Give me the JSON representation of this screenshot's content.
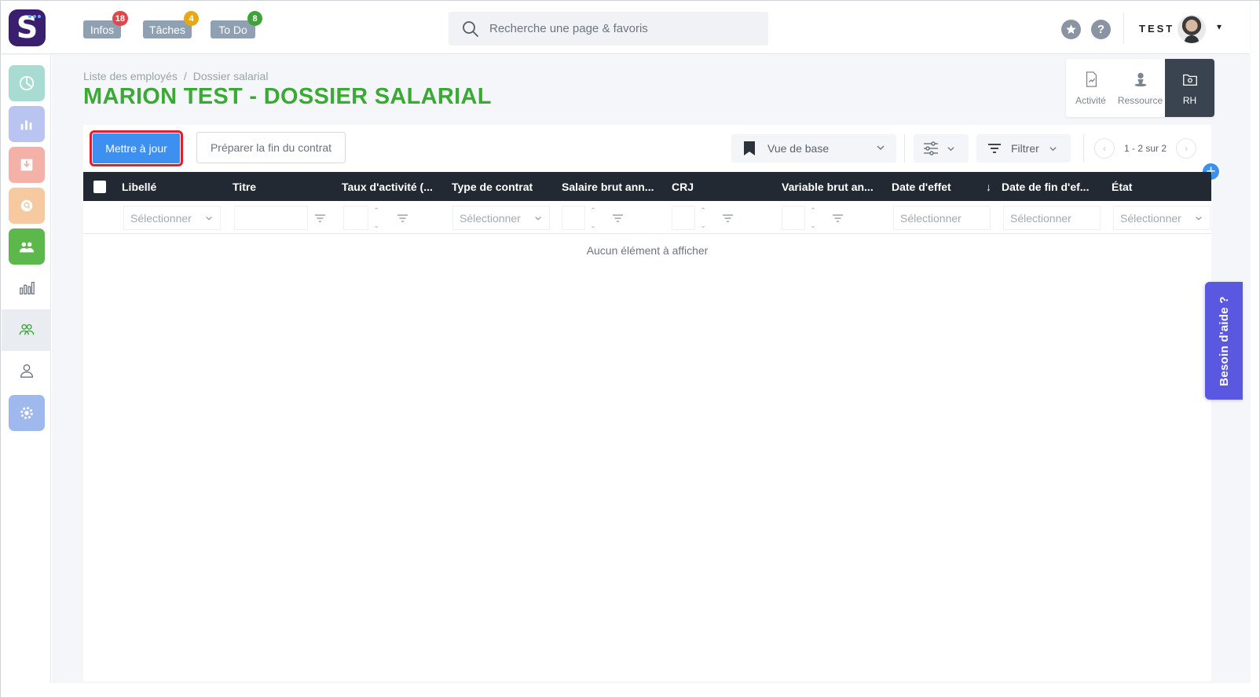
{
  "app": {
    "logo_letter": "S",
    "brand_color": "#3a1f6e"
  },
  "header": {
    "nav": [
      {
        "label": "Infos",
        "badge": "18",
        "badge_color": "#e0474c"
      },
      {
        "label": "Tâches",
        "badge": "4",
        "badge_color": "#e6a817"
      },
      {
        "label": "To Do",
        "badge": "8",
        "badge_color": "#3fa33a"
      }
    ],
    "search_placeholder": "Recherche une page & favoris",
    "help_q": "?",
    "company": "TEST",
    "caret": "▾"
  },
  "sidebar": {
    "items": [
      {
        "icon": "pie-chart-icon",
        "color": "#a8dcd2"
      },
      {
        "icon": "bar-chart-icon",
        "color": "#b9c4f0"
      },
      {
        "icon": "inbox-download-icon",
        "color": "#f3b1a7"
      },
      {
        "icon": "coin-search-icon",
        "color": "#f7c9a0"
      },
      {
        "icon": "team-icon",
        "color": "#5cb84a"
      },
      {
        "icon": "stats-icon",
        "color": ""
      },
      {
        "icon": "users-outline-icon",
        "color": ""
      },
      {
        "icon": "user-icon",
        "color": ""
      },
      {
        "icon": "gear-icon",
        "color": "#9fb8ee"
      }
    ]
  },
  "breadcrumb": {
    "items": [
      "Liste des employés",
      "Dossier salarial"
    ],
    "separator": "/"
  },
  "page": {
    "title": "MARION TEST - DOSSIER SALARIAL",
    "title_color": "#3aaa35"
  },
  "tabs": [
    {
      "label": "Activité",
      "icon": "chart-doc-icon",
      "active": false
    },
    {
      "label": "Ressource",
      "icon": "person-pin-icon",
      "active": false
    },
    {
      "label": "RH",
      "icon": "folder-icon",
      "active": true
    }
  ],
  "toolbar": {
    "primary_label": "Mettre à jour",
    "secondary_label": "Préparer la fin du contrat",
    "view_label": "Vue de base",
    "filter_label": "Filtrer",
    "pagination": "1 - 2 sur 2"
  },
  "table": {
    "columns": [
      "Libellé",
      "Titre",
      "Taux d'activité (...",
      "Type de contrat",
      "Salaire brut ann...",
      "CRJ",
      "Variable brut an...",
      "Date d'effet",
      "Date de fin d'ef...",
      "État"
    ],
    "sort_indicator": "↓",
    "filter_placeholder": "Sélectionner",
    "empty_message": "Aucun élément à afficher"
  },
  "help_widget": {
    "label": "Besoin d'aide ?"
  }
}
